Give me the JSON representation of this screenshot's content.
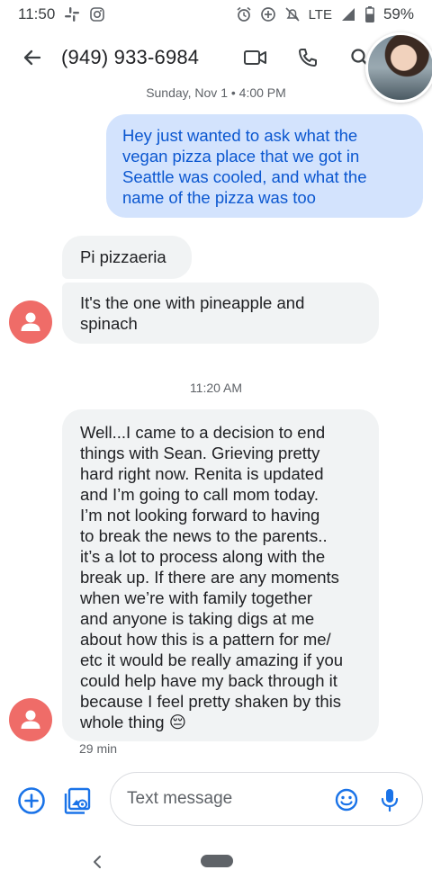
{
  "status_bar": {
    "time": "11:50",
    "network": "LTE",
    "battery": "59%",
    "icons": [
      "slack-icon",
      "instagram-icon",
      "alarm-icon",
      "data-saver-icon",
      "do-not-disturb-off-icon",
      "signal-icon",
      "battery-icon"
    ]
  },
  "header": {
    "back_icon": "arrow-back-icon",
    "title": "(949) 933-6984",
    "actions": [
      "video-call-icon",
      "phone-icon",
      "search-icon"
    ]
  },
  "conversation": {
    "date_stamp": "Sunday, Nov 1 • 4:00 PM",
    "outgoing": [
      {
        "text": "Hey just wanted to ask what the vegan pizza place that we got in Seattle was cooled, and what the name of the pizza was too"
      }
    ],
    "incoming_group_1": [
      {
        "text": "Pi pizzaeria"
      },
      {
        "text": "It's the one with pineapple and spinach"
      }
    ],
    "time_stamp": "11:20 AM",
    "incoming_group_2": {
      "lines": [
        "Well...I came to a decision to end",
        "things with Sean. Grieving pretty",
        "hard right now. Renita is updated",
        "and I’m going to call mom today.",
        "I’m not looking forward to having",
        "to break the news to the parents..",
        "it’s a lot to process along with the",
        "break up. If there are any moments",
        "when we’re with family together",
        "and anyone is taking digs at me",
        "about how this is a pattern for me/",
        "etc it would be really amazing if you",
        "could help have my back through it",
        "because I feel pretty shaken by this",
        "whole thing"
      ],
      "emoji": "😔",
      "relative_time": "29 min"
    }
  },
  "compose": {
    "placeholder": "Text message",
    "left_icons": [
      "add-circle-icon",
      "gallery-icon"
    ],
    "right_icons": [
      "emoji-icon",
      "microphone-icon"
    ]
  },
  "colors": {
    "outgoing_bubble": "#d3e3fd",
    "outgoing_text": "#0b57d0",
    "incoming_bubble": "#f1f3f4",
    "contact_avatar": "#ef6c68",
    "accent": "#1a73e8"
  }
}
